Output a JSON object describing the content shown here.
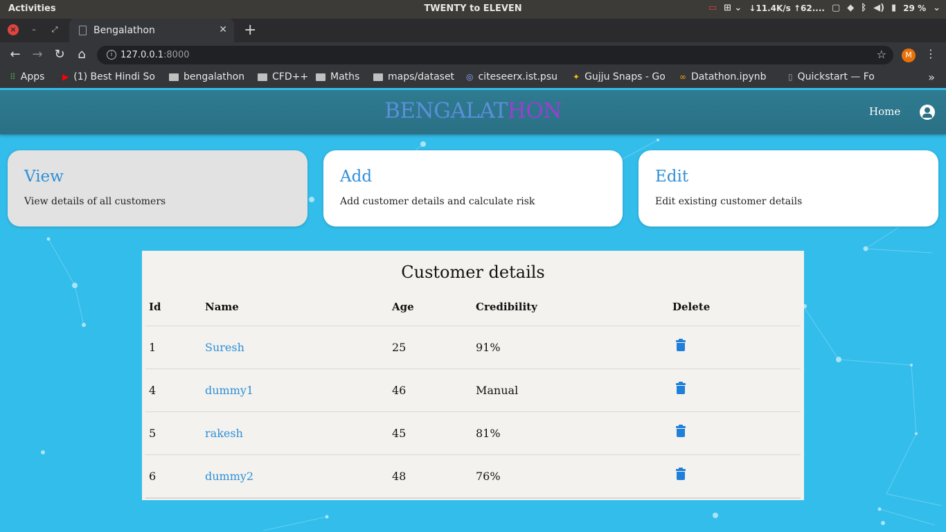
{
  "os": {
    "activities": "Activities",
    "clock": "TWENTY to ELEVEN",
    "net_speed": "↓11.4K/s ↑62....",
    "battery": "29 %"
  },
  "browser": {
    "tab_title": "Bengalathon",
    "url_host": "127.0.0.1",
    "url_port": ":8000",
    "profile_initial": "M"
  },
  "bookmarks": [
    {
      "label": "Apps",
      "icon": "apps-grid-icon"
    },
    {
      "label": "(1) Best Hindi So",
      "icon": "youtube-icon"
    },
    {
      "label": "bengalathon",
      "icon": "folder-icon"
    },
    {
      "label": "CFD++",
      "icon": "folder-icon"
    },
    {
      "label": "Maths",
      "icon": "folder-icon"
    },
    {
      "label": "maps/dataset",
      "icon": "folder-icon"
    },
    {
      "label": "citeseerx.ist.psu",
      "icon": "citeseer-icon"
    },
    {
      "label": "Gujju Snaps - Go",
      "icon": "photos-icon"
    },
    {
      "label": "Datathon.ipynb",
      "icon": "colab-icon"
    },
    {
      "label": "Quickstart — Fo",
      "icon": "page-icon"
    }
  ],
  "app": {
    "brand_part1": "BENGALAT",
    "brand_part2": "HON",
    "nav_home": "Home",
    "colors": {
      "navbar": "#2b7085",
      "background": "#33bdeb",
      "accent": "#2f8fd8",
      "brand_blue": "#5b8fd8",
      "brand_purple": "#9b3fd0"
    }
  },
  "cards": [
    {
      "title": "View",
      "desc": "View details of all customers",
      "active": true
    },
    {
      "title": "Add",
      "desc": "Add customer details and calculate risk",
      "active": false
    },
    {
      "title": "Edit",
      "desc": "Edit existing customer details",
      "active": false
    }
  ],
  "table": {
    "title": "Customer details",
    "headers": [
      "Id",
      "Name",
      "Age",
      "Credibility",
      "Delete"
    ],
    "rows": [
      {
        "id": "1",
        "name": "Suresh",
        "age": "25",
        "cred": "91%"
      },
      {
        "id": "4",
        "name": "dummy1",
        "age": "46",
        "cred": "Manual"
      },
      {
        "id": "5",
        "name": "rakesh",
        "age": "45",
        "cred": "81%"
      },
      {
        "id": "6",
        "name": "dummy2",
        "age": "48",
        "cred": "76%"
      }
    ]
  }
}
